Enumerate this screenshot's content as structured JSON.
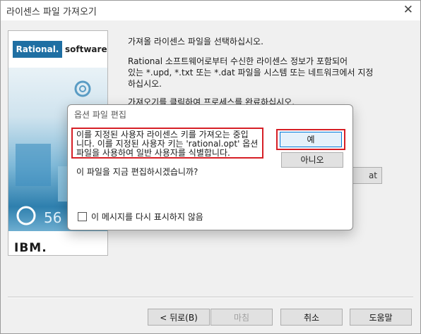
{
  "window": {
    "title": "라이센스 파일 가져오기",
    "close_glyph": "✕"
  },
  "banner": {
    "logo_brand": "Rational.",
    "logo_product": "software",
    "vendor": "IBM."
  },
  "description": {
    "line1": "가져올 라이센스 파일을 선택하십시오.",
    "line2a": "Rational 소프트웨어로부터 수신한 라이센스 정보가 포함되어",
    "line2b": "있는 *.upd, *.txt 또는 *.dat 파일을 시스템 또는 네트워크에서 지정",
    "line2c": "하십시오.",
    "line3": "가져오기를 클릭하여 프로세스를 완료하십시오."
  },
  "background_button_fragment": "at",
  "footer": {
    "back": "< 뒤로(B)",
    "finish": "마침",
    "cancel": "취소",
    "help": "도움말"
  },
  "dialog": {
    "title": "옵션 파일 편집",
    "message_line1": "이를 지정된 사용자 라이센스 키를 가져오는 중입",
    "message_line2": "니다. 이를 지정된 사용자 키는 'rational.opt' 옵션",
    "message_line3": "파일을 사용하여 일반 사용자를 식별합니다.",
    "question": "이 파일을 지금 편집하시겠습니까?",
    "yes": "예",
    "no": "아니오",
    "checkbox_label": "이 메시지를 다시 표시하지 않음"
  },
  "colors": {
    "highlight": "#d61f26",
    "brand_blue": "#1f6fa3"
  }
}
